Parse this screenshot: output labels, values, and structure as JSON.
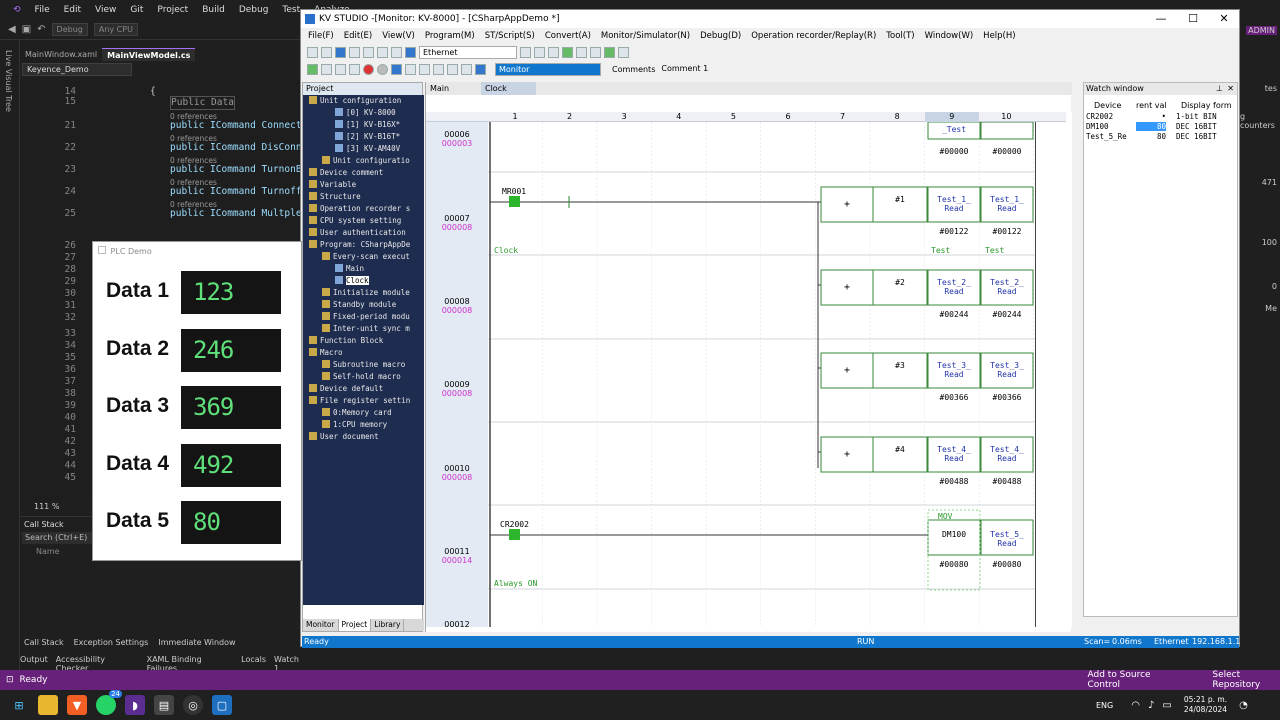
{
  "vs": {
    "menu": [
      "File",
      "Edit",
      "View",
      "Git",
      "Project",
      "Build",
      "Debug",
      "Test",
      "Analyze"
    ],
    "toolbar": {
      "config": "Debug",
      "platform": "Any CPU"
    },
    "sidebar_label": "Live Visual Tree",
    "tabs": [
      "MainWindow.xaml",
      "MainViewModel.cs"
    ],
    "nav": "Keyence_Demo",
    "zoom": "111 %",
    "code_lines": [
      {
        "ln": "14",
        "code": "{",
        "type": "code"
      },
      {
        "ln": "15",
        "code": "Public Data",
        "type": "hint"
      },
      {
        "ln": "",
        "code": "0 references",
        "type": "ref"
      },
      {
        "ln": "21",
        "code": "public ICommand ConnectCmd",
        "type": "code"
      },
      {
        "ln": "",
        "code": "0 references",
        "type": "ref"
      },
      {
        "ln": "22",
        "code": "public ICommand DisConnectC",
        "type": "code"
      },
      {
        "ln": "",
        "code": "0 references",
        "type": "ref"
      },
      {
        "ln": "23",
        "code": "public ICommand TurnonBitC",
        "type": "code"
      },
      {
        "ln": "",
        "code": "0 references",
        "type": "ref"
      },
      {
        "ln": "24",
        "code": "public ICommand TurnoffBitC",
        "type": "code"
      },
      {
        "ln": "",
        "code": "0 references",
        "type": "ref"
      },
      {
        "ln": "25",
        "code": "public ICommand MultpleWri",
        "type": "code"
      },
      {
        "ln": "26",
        "code": "",
        "type": "code"
      },
      {
        "ln": "27",
        "code": "",
        "type": "code"
      },
      {
        "ln": "28",
        "code": "",
        "type": "code"
      },
      {
        "ln": "29",
        "code": "",
        "type": "code"
      },
      {
        "ln": "30",
        "code": "",
        "type": "code"
      },
      {
        "ln": "31",
        "code": "",
        "type": "code"
      },
      {
        "ln": "32",
        "code": "",
        "type": "code"
      },
      {
        "ln": "33",
        "code": "",
        "type": "code"
      },
      {
        "ln": "34",
        "code": "",
        "type": "code"
      },
      {
        "ln": "35",
        "code": "",
        "type": "code"
      },
      {
        "ln": "36",
        "code": "",
        "type": "code"
      },
      {
        "ln": "37",
        "code": "",
        "type": "code"
      },
      {
        "ln": "38",
        "code": "",
        "type": "code"
      },
      {
        "ln": "39",
        "code": "",
        "type": "code"
      },
      {
        "ln": "40",
        "code": "",
        "type": "code"
      },
      {
        "ln": "41",
        "code": "",
        "type": "code"
      },
      {
        "ln": "42",
        "code": "",
        "type": "code"
      },
      {
        "ln": "43",
        "code": "",
        "type": "code"
      },
      {
        "ln": "44",
        "code": "",
        "type": "code"
      },
      {
        "ln": "45",
        "code": "",
        "type": "code"
      }
    ],
    "callstack": {
      "title": "Call Stack",
      "search": "Search (Ctrl+E)",
      "col": "Name"
    },
    "bottom_tabs1": [
      "Call Stack",
      "Exception Settings",
      "Immediate Window"
    ],
    "bottom_tabs2": [
      "Output",
      "Accessibility Checker",
      "XAML Binding Failures",
      "Locals",
      "Watch 1"
    ],
    "status": {
      "ready": "Ready",
      "source": "Add to Source Control",
      "repo": "Select Repository"
    },
    "right": {
      "admin": "ADMIN",
      "tes": "tes",
      "counters": "g counters",
      "v471": "471",
      "v100": "100",
      "v0": "0",
      "me": "Me"
    }
  },
  "plc": {
    "title": "PLC Demo",
    "rows": [
      {
        "label": "Data 1",
        "value": "123"
      },
      {
        "label": "Data 2",
        "value": "246"
      },
      {
        "label": "Data 3",
        "value": "369"
      },
      {
        "label": "Data 4",
        "value": "492"
      },
      {
        "label": "Data 5",
        "value": "80"
      }
    ]
  },
  "kv": {
    "title": "KV STUDIO -[Monitor: KV-8000] - [CSharpAppDemo *]",
    "menu": [
      "File(F)",
      "Edit(E)",
      "View(V)",
      "Program(M)",
      "ST/Script(S)",
      "Convert(A)",
      "Monitor/Simulator(N)",
      "Debug(D)",
      "Operation recorder/Replay(R)",
      "Tool(T)",
      "Window(W)",
      "Help(H)"
    ],
    "connection": "Ethernet",
    "mode": "Monitor",
    "comments_label": "Comments",
    "comments_value": "Comment 1",
    "project": {
      "header": "Project",
      "tree": [
        {
          "indent": 0,
          "text": "Unit configuration"
        },
        {
          "indent": 2,
          "text": "[0]  KV-8000"
        },
        {
          "indent": 2,
          "text": "[1]  KV-B16X*"
        },
        {
          "indent": 2,
          "text": "[2]  KV-B16T*"
        },
        {
          "indent": 2,
          "text": "[3]  KV-AM40V"
        },
        {
          "indent": 1,
          "text": "Unit configuratio"
        },
        {
          "indent": 0,
          "text": "Device comment"
        },
        {
          "indent": 0,
          "text": "Variable"
        },
        {
          "indent": 0,
          "text": "Structure"
        },
        {
          "indent": 0,
          "text": "Operation recorder s"
        },
        {
          "indent": 0,
          "text": "CPU system setting"
        },
        {
          "indent": 0,
          "text": "User authentication"
        },
        {
          "indent": 0,
          "text": "Program: CSharpAppDe"
        },
        {
          "indent": 1,
          "text": "Every-scan execut"
        },
        {
          "indent": 2,
          "text": "Main"
        },
        {
          "indent": 2,
          "text": "Clock",
          "selected": true
        },
        {
          "indent": 1,
          "text": "Initialize module"
        },
        {
          "indent": 1,
          "text": "Standby module"
        },
        {
          "indent": 1,
          "text": "Fixed-period modu"
        },
        {
          "indent": 1,
          "text": "Inter-unit sync m"
        },
        {
          "indent": 0,
          "text": "Function Block"
        },
        {
          "indent": 0,
          "text": "Macro"
        },
        {
          "indent": 1,
          "text": "Subroutine macro"
        },
        {
          "indent": 1,
          "text": "Self-hold macro"
        },
        {
          "indent": 0,
          "text": "Device default"
        },
        {
          "indent": 0,
          "text": "File register settin"
        },
        {
          "indent": 1,
          "text": "0:Memory card"
        },
        {
          "indent": 1,
          "text": "1:CPU memory"
        },
        {
          "indent": 0,
          "text": "User document"
        }
      ],
      "tabs": [
        "Monitor",
        "Project",
        "Library"
      ]
    },
    "ladder_tabs": [
      "Main",
      "Clock"
    ],
    "columns": [
      "1",
      "2",
      "3",
      "4",
      "5",
      "6",
      "7",
      "8",
      "9",
      "10"
    ],
    "rungs": [
      {
        "a": "00006",
        "b": "000003"
      },
      {
        "a": "00007",
        "b": "000008"
      },
      {
        "a": "00008",
        "b": "000008"
      },
      {
        "a": "00009",
        "b": "000008"
      },
      {
        "a": "00010",
        "b": "000008"
      },
      {
        "a": "00011",
        "b": "000014"
      },
      {
        "a": "00012",
        "b": ""
      }
    ],
    "ladder": {
      "top9": "_Test",
      "top9v": "#00000",
      "top10v": "#00000",
      "mr": "MR001",
      "clock": "Clock",
      "clock_test1": "Test",
      "clock_test2": "Test",
      "plus": "+",
      "adds": [
        {
          "n": "#1",
          "a": "Test_1_",
          "b": "Read",
          "c": "Test_1_",
          "d": "Read",
          "va": "#00122",
          "vb": "#00122"
        },
        {
          "n": "#2",
          "a": "Test_2_",
          "b": "Read",
          "c": "Test_2_",
          "d": "Read",
          "va": "#00244",
          "vb": "#00244"
        },
        {
          "n": "#3",
          "a": "Test_3_",
          "b": "Read",
          "c": "Test_3_",
          "d": "Read",
          "va": "#00366",
          "vb": "#00366"
        },
        {
          "n": "#4",
          "a": "Test_4_",
          "b": "Read",
          "c": "Test_4_",
          "d": "Read",
          "va": "#00488",
          "vb": "#00488"
        }
      ],
      "cr": "CR2002",
      "always": "Always ON",
      "mov": "MOV",
      "dm": "DM100",
      "t5a": "Test_5_",
      "t5b": "Read",
      "v80a": "#00080",
      "v80b": "#00080"
    },
    "watch": {
      "title": "Watch window",
      "headers": [
        "Device",
        "rent val",
        "Display form"
      ],
      "rows": [
        {
          "device": "CR2002",
          "value": "•",
          "form": "1-bit BIN"
        },
        {
          "device": "DM100",
          "value": "80",
          "form": "DEC 16BIT"
        },
        {
          "device": "Test_5_Re",
          "value": "80",
          "form": "DEC 16BIT"
        }
      ]
    },
    "status": {
      "ready": "Ready",
      "run": "RUN",
      "scan": "Scan=",
      "scan_v": "0.06ms",
      "eth": "Ethernet",
      "ip": "192.168.1.1"
    }
  },
  "taskbar": {
    "lang": "ENG",
    "time": "05:21 p. m.",
    "date": "24/08/2024",
    "badge": "24"
  }
}
